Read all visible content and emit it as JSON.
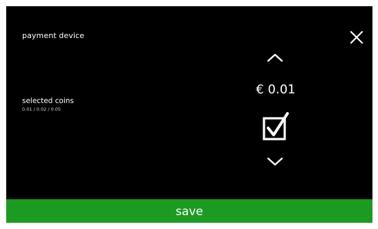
{
  "screen": {
    "title": "payment device"
  },
  "close": {
    "icon": "close-icon"
  },
  "coins": {
    "label": "selected coins",
    "list": "0.01 / 0.02 / 0.05"
  },
  "selector": {
    "up_icon": "chevron-up-icon",
    "value": "€ 0.01",
    "checked": true,
    "checkbox_icon": "checkbox-checked-icon",
    "down_icon": "chevron-down-icon"
  },
  "save": {
    "label": "save"
  },
  "colors": {
    "background": "#000000",
    "text": "#ffffff",
    "save_bar": "#1d9a22"
  }
}
